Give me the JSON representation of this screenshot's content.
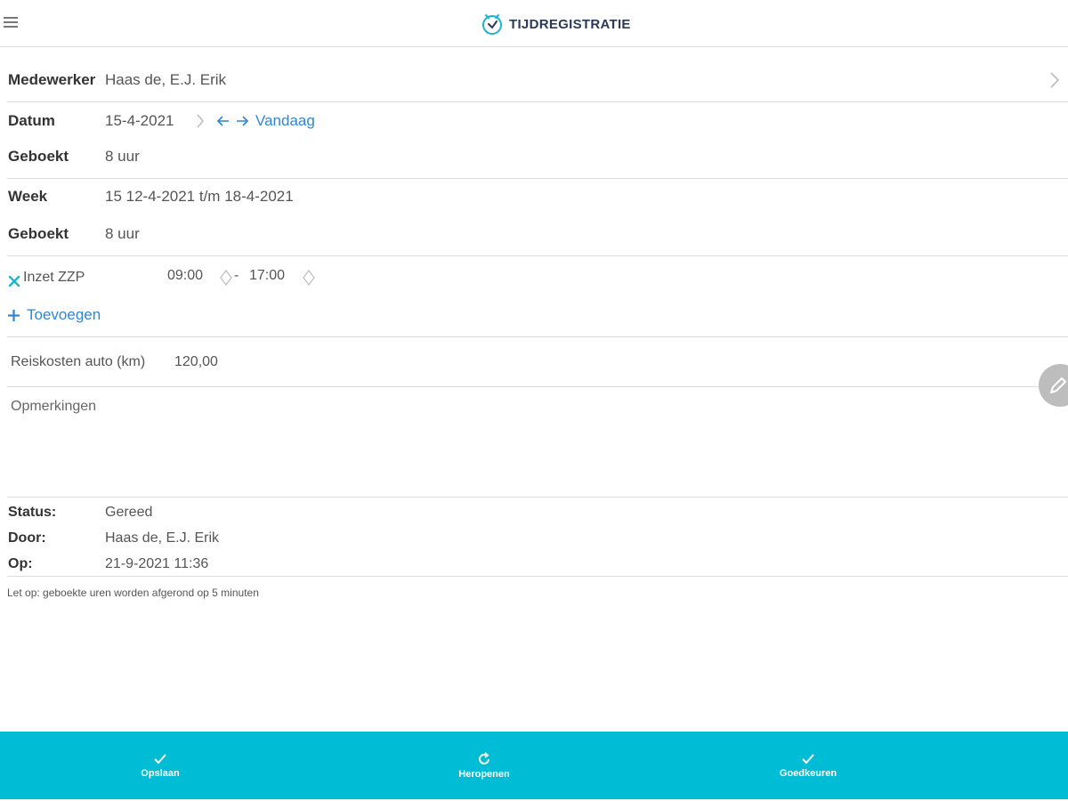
{
  "header": {
    "title": "TIJDREGISTRATIE",
    "icons": [
      "menu-icon",
      "clock-icon"
    ]
  },
  "employee": {
    "label": "Medewerker",
    "value": "Haas de, E.J. Erik"
  },
  "date": {
    "label": "Datum",
    "value": "15-4-2021",
    "today_label": "Vandaag"
  },
  "day_booked": {
    "label": "Geboekt",
    "value": "8 uur"
  },
  "week": {
    "label": "Week",
    "value": "15 12-4-2021 t/m 18-4-2021"
  },
  "week_booked": {
    "label": "Geboekt",
    "value": "8 uur"
  },
  "entries": [
    {
      "name": "Inzet ZZP",
      "start": "09:00",
      "separator": "-",
      "end": "17:00"
    }
  ],
  "add_label": "Toevoegen",
  "travel": {
    "label": "Reiskosten auto (km)",
    "value": "120,00"
  },
  "remarks": {
    "placeholder": "Opmerkingen"
  },
  "status": {
    "status_label": "Status:",
    "status_value": "Gereed",
    "by_label": "Door:",
    "by_value": "Haas de, E.J. Erik",
    "on_label": "Op:",
    "on_value": "21-9-2021 11:36"
  },
  "note": "Let op: geboekte uren worden afgerond op 5 minuten",
  "footer": {
    "save_label": "Opslaan",
    "reopen_label": "Heropenen",
    "approve_label": "Goedkeuren"
  },
  "colors": {
    "accent": "#00bcd4",
    "link": "#2f86d8",
    "brand": "#2b3a55"
  }
}
